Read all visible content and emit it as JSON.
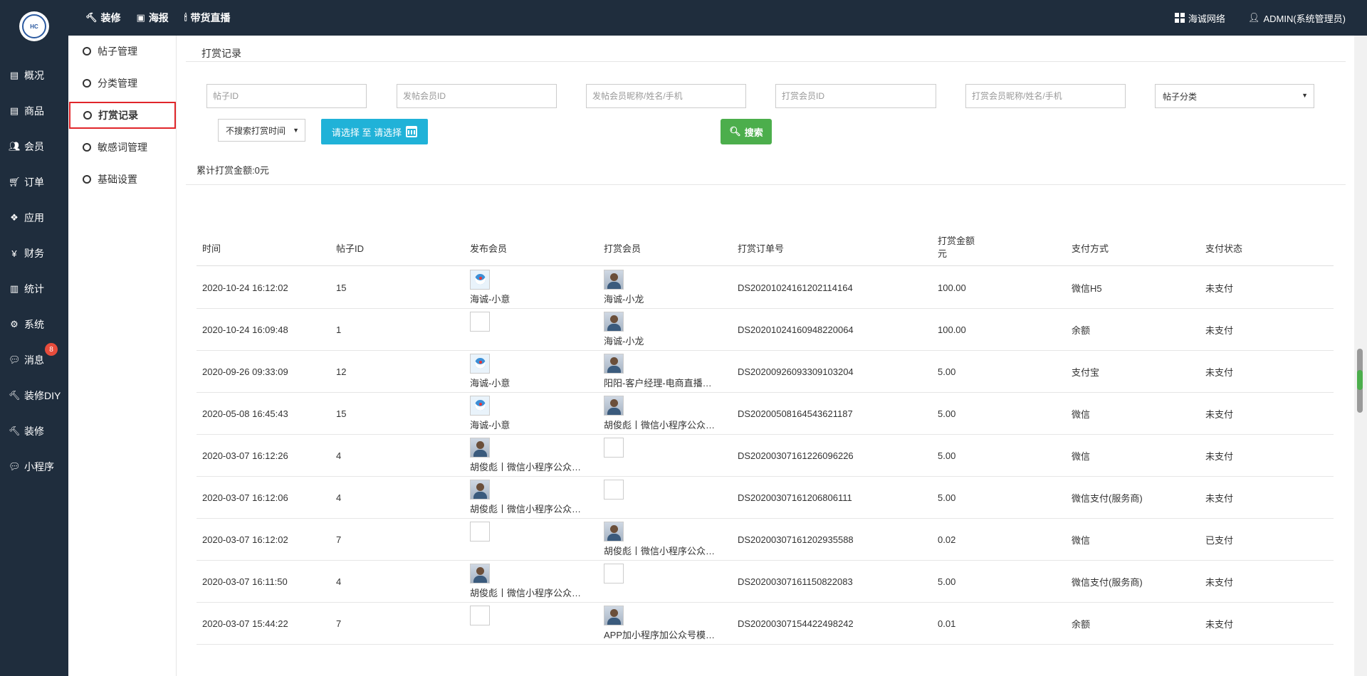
{
  "topnav": {
    "items": [
      {
        "icon": "hammer-icon",
        "label": "装修"
      },
      {
        "icon": "image-icon",
        "label": "海报"
      },
      {
        "icon": "torch-icon",
        "label": "带货直播"
      }
    ],
    "right": {
      "shop_label": "海诚网络",
      "user_label": "ADMIN(系统管理员)"
    }
  },
  "sidebar": {
    "items": [
      {
        "icon": "dashboard-icon",
        "label": "概况"
      },
      {
        "icon": "goods-icon",
        "label": "商品"
      },
      {
        "icon": "users-icon",
        "label": "会员"
      },
      {
        "icon": "cart-icon",
        "label": "订单"
      },
      {
        "icon": "apps-icon",
        "label": "应用"
      },
      {
        "icon": "yen-icon",
        "label": "财务"
      },
      {
        "icon": "bar-chart-icon",
        "label": "统计"
      },
      {
        "icon": "gears-icon",
        "label": "系统"
      },
      {
        "icon": "chat-icon",
        "label": "消息",
        "badge": "8"
      },
      {
        "icon": "hammer-icon",
        "label": "装修DIY"
      },
      {
        "icon": "hammer-icon",
        "label": "装修"
      },
      {
        "icon": "wechat-icon",
        "label": "小程序"
      }
    ]
  },
  "subnav": {
    "items": [
      {
        "label": "帖子管理",
        "active": false
      },
      {
        "label": "分类管理",
        "active": false
      },
      {
        "label": "打赏记录",
        "active": true
      },
      {
        "label": "敏感词管理",
        "active": false
      },
      {
        "label": "基础设置",
        "active": false
      }
    ]
  },
  "page": {
    "breadcrumb": "打赏记录",
    "filters": {
      "post_id_placeholder": "帖子ID",
      "poster_id_placeholder": "发帖会员ID",
      "poster_name_placeholder": "发帖会员昵称/姓名/手机",
      "tipper_id_placeholder": "打赏会员ID",
      "tipper_name_placeholder": "打赏会员昵称/姓名/手机",
      "category_select": "帖子分类",
      "time_select": "不搜索打赏时间",
      "date_range_label": "请选择 至 请选择",
      "search_label": "搜索"
    },
    "total_label": "累计打赏金额:0元"
  },
  "table": {
    "headers": {
      "time": "时间",
      "post_id": "帖子ID",
      "poster": "发布会员",
      "tipper": "打赏会员",
      "order_no": "打赏订单号",
      "amount_line1": "打赏金额",
      "amount_line2": "元",
      "pay_method": "支付方式",
      "pay_status": "支付状态"
    },
    "rows": [
      {
        "time": "2020-10-24 16:12:02",
        "post_id": "15",
        "poster_avatar": "dora",
        "poster_name": "海诚-小意",
        "tipper_avatar": "photo",
        "tipper_name": "海诚-小龙",
        "order_no": "DS20201024161202114164",
        "amount": "100.00",
        "pay_method": "微信H5",
        "pay_status": "未支付"
      },
      {
        "time": "2020-10-24 16:09:48",
        "post_id": "1",
        "poster_avatar": "empty",
        "poster_name": "",
        "tipper_avatar": "photo",
        "tipper_name": "海诚-小龙",
        "order_no": "DS20201024160948220064",
        "amount": "100.00",
        "pay_method": "余额",
        "pay_status": "未支付"
      },
      {
        "time": "2020-09-26 09:33:09",
        "post_id": "12",
        "poster_avatar": "dora",
        "poster_name": "海诚-小意",
        "tipper_avatar": "photo",
        "tipper_name": "阳阳-客户经理-电商直播…",
        "order_no": "DS20200926093309103204",
        "amount": "5.00",
        "pay_method": "支付宝",
        "pay_status": "未支付"
      },
      {
        "time": "2020-05-08 16:45:43",
        "post_id": "15",
        "poster_avatar": "dora",
        "poster_name": "海诚-小意",
        "tipper_avatar": "photo",
        "tipper_name": "胡俊彪丨微信小程序公众…",
        "order_no": "DS20200508164543621187",
        "amount": "5.00",
        "pay_method": "微信",
        "pay_status": "未支付"
      },
      {
        "time": "2020-03-07 16:12:26",
        "post_id": "4",
        "poster_avatar": "photo",
        "poster_name": "胡俊彪丨微信小程序公众…",
        "tipper_avatar": "empty",
        "tipper_name": "",
        "order_no": "DS20200307161226096226",
        "amount": "5.00",
        "pay_method": "微信",
        "pay_status": "未支付"
      },
      {
        "time": "2020-03-07 16:12:06",
        "post_id": "4",
        "poster_avatar": "photo",
        "poster_name": "胡俊彪丨微信小程序公众…",
        "tipper_avatar": "empty",
        "tipper_name": "",
        "order_no": "DS20200307161206806111",
        "amount": "5.00",
        "pay_method": "微信支付(服务商)",
        "pay_status": "未支付"
      },
      {
        "time": "2020-03-07 16:12:02",
        "post_id": "7",
        "poster_avatar": "empty",
        "poster_name": "",
        "tipper_avatar": "photo",
        "tipper_name": "胡俊彪丨微信小程序公众…",
        "order_no": "DS20200307161202935588",
        "amount": "0.02",
        "pay_method": "微信",
        "pay_status": "已支付"
      },
      {
        "time": "2020-03-07 16:11:50",
        "post_id": "4",
        "poster_avatar": "photo",
        "poster_name": "胡俊彪丨微信小程序公众…",
        "tipper_avatar": "empty",
        "tipper_name": "",
        "order_no": "DS20200307161150822083",
        "amount": "5.00",
        "pay_method": "微信支付(服务商)",
        "pay_status": "未支付"
      },
      {
        "time": "2020-03-07 15:44:22",
        "post_id": "7",
        "poster_avatar": "empty",
        "poster_name": "",
        "tipper_avatar": "photo",
        "tipper_name": "APP加小程序加公众号模…",
        "order_no": "DS20200307154422498242",
        "amount": "0.01",
        "pay_method": "余额",
        "pay_status": "未支付"
      }
    ]
  },
  "colors": {
    "sidebar_bg": "#1f2d3d",
    "date_button": "#20b2d8",
    "search_button": "#4cae4c",
    "active_border": "#e0262a",
    "badge": "#e74c3c"
  }
}
